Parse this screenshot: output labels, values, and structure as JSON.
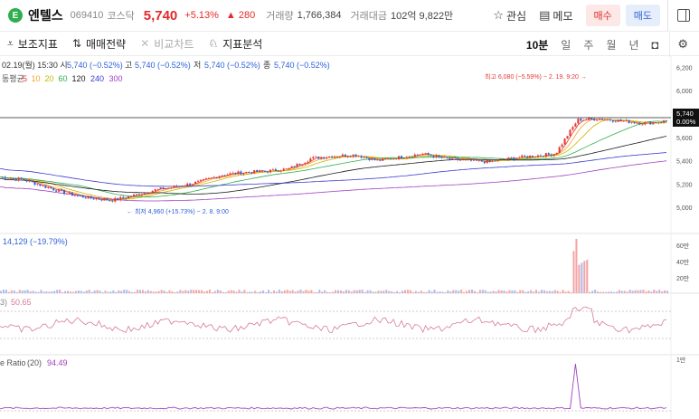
{
  "stock": {
    "logo_letter": "E",
    "name": "엔텔스",
    "code": "069410",
    "market": "코스닥",
    "price": "5,740",
    "change_pct": "+5.13%",
    "change_abs": "▲ 280",
    "volume_label": "거래량",
    "volume": "1,766,384",
    "amount_label": "거래대금",
    "amount": "102억 9,822만"
  },
  "header_actions": {
    "watch": "관심",
    "memo": "메모",
    "buy": "매수",
    "sell": "매도"
  },
  "toolbar": {
    "indicators": "보조지표",
    "trade_strategy": "매매전략",
    "compare": "비교차트",
    "analysis": "지표분석",
    "timeframes": [
      "10분",
      "일",
      "주",
      "월",
      "년"
    ],
    "active_timeframe": "10분"
  },
  "chart": {
    "ohlc_line": {
      "date": "02.19(월) 15:30 시",
      "open": "5,740 (−0.52%)",
      "high_label": "고",
      "high": "5,740 (−0.52%)",
      "low_label": "저",
      "low": "5,740 (−0.52%)",
      "close_label": "종",
      "close": "5,740 (−0.52%)"
    },
    "ma_legend": {
      "label": "동평균",
      "periods": [
        "5",
        "10",
        "20",
        "60",
        "120",
        "240",
        "300"
      ],
      "colors": [
        "#e53935",
        "#f5a623",
        "#c9b800",
        "#2fae4e",
        "#1e1e1e",
        "#3a3ad0",
        "#a040c0"
      ]
    },
    "high_annotation": "최고 6,080 (−5.59%) − 2. 19. 9:20 →",
    "low_annotation": "← 최저 4,960 (+15.73%) − 2. 8. 9:00",
    "price_axis": [
      "6,200",
      "6,000",
      "5,800",
      "5,600",
      "5,400",
      "5,200",
      "5,000"
    ],
    "current_price_tag": "5,740",
    "current_pct_tag": "0.00%",
    "volume_pane": {
      "label": "14,129 (−19.79%)",
      "axis": [
        "60만",
        "40만",
        "20만"
      ]
    },
    "rsi_pane": {
      "prefix": "3)",
      "value": "50.65"
    },
    "volume_ratio_pane": {
      "label": "e Ratio",
      "period": "(20)",
      "value": "94.49",
      "axis_top": "1만"
    },
    "colors": {
      "up": "#e53935",
      "down": "#2f63d8",
      "rsi": "#d77a9a",
      "vr": "#a040c0"
    },
    "chart_data": {
      "type": "line",
      "title": "",
      "xlabel": "",
      "ylabel": "",
      "ylim": [
        4900,
        6250
      ],
      "series": [
        {
          "values": [
            5260,
            5240,
            5180,
            5120,
            5080,
            5060,
            5100,
            5150,
            5180,
            5220,
            5280,
            5300,
            5310,
            5330,
            5420,
            5440,
            5450,
            5400,
            5430,
            5460,
            5420,
            5400,
            5390,
            5420,
            5440,
            5460,
            5750,
            5760,
            5740,
            5720,
            5740
          ]
        }
      ]
    }
  }
}
